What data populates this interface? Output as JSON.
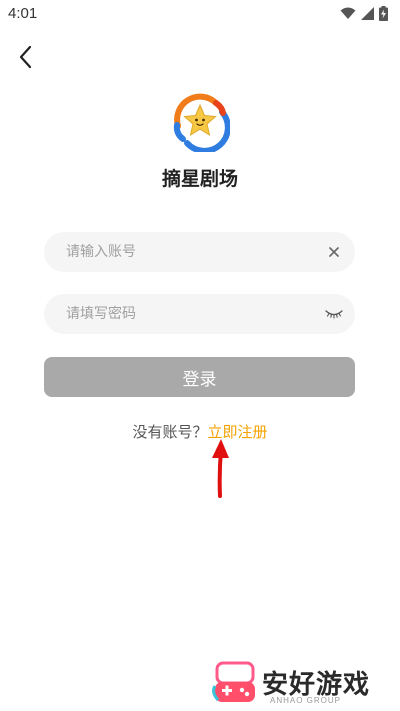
{
  "status_bar": {
    "time": "4:01",
    "icons": [
      "wifi-icon",
      "cell-signal-icon",
      "battery-icon"
    ]
  },
  "nav": {
    "back_icon": "chevron-left-icon"
  },
  "app": {
    "logo_icon": "star-logo-icon",
    "name": "摘星剧场"
  },
  "form": {
    "account": {
      "value": "",
      "placeholder": "请输入账号",
      "trailing_icon": "clear-icon"
    },
    "password": {
      "value": "",
      "placeholder": "请填写密码",
      "trailing_icon": "eye-closed-icon"
    },
    "login_label": "登录"
  },
  "register": {
    "prompt": "没有账号？",
    "link": "立即注册"
  },
  "watermark": {
    "text": "安好游戏",
    "sub": "ANHAO GROUP"
  },
  "colors": {
    "accent": "#f5a100",
    "login_bg": "#a9a9a9",
    "input_bg": "#f5f5f5",
    "annotation": "#e01010",
    "logo_blue": "#2f7de1",
    "logo_orange": "#f07d1a",
    "logo_star": "#f7c843"
  }
}
